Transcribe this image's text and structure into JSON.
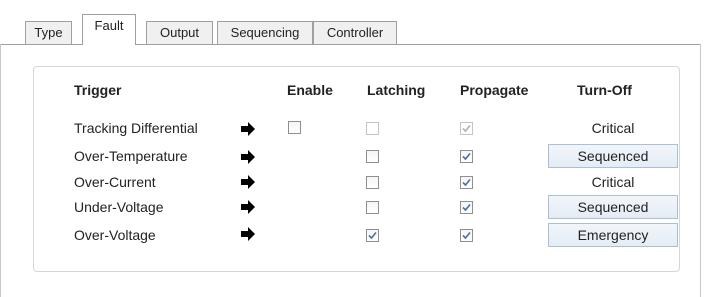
{
  "tabs": [
    {
      "label": "Type",
      "active": false
    },
    {
      "label": "Fault",
      "active": true
    },
    {
      "label": "Output",
      "active": false
    },
    {
      "label": "Sequencing",
      "active": false
    },
    {
      "label": "Controller",
      "active": false
    }
  ],
  "headers": {
    "trigger": "Trigger",
    "enable": "Enable",
    "latching": "Latching",
    "propagate": "Propagate",
    "turn_off": "Turn-Off"
  },
  "rows": [
    {
      "trigger": "Tracking Differential",
      "enable": "unchecked",
      "latching": "disabled-unchecked",
      "propagate": "disabled-checked",
      "turn_off": "Critical",
      "turn_off_style": "text"
    },
    {
      "trigger": "Over-Temperature",
      "enable": "none",
      "latching": "unchecked",
      "propagate": "checked",
      "turn_off": "Sequenced",
      "turn_off_style": "button"
    },
    {
      "trigger": "Over-Current",
      "enable": "none",
      "latching": "unchecked",
      "propagate": "checked",
      "turn_off": "Critical",
      "turn_off_style": "text"
    },
    {
      "trigger": "Under-Voltage",
      "enable": "none",
      "latching": "unchecked",
      "propagate": "checked",
      "turn_off": "Sequenced",
      "turn_off_style": "button"
    },
    {
      "trigger": "Over-Voltage",
      "enable": "none",
      "latching": "checked",
      "propagate": "checked",
      "turn_off": "Emergency",
      "turn_off_style": "button"
    }
  ],
  "icons": {
    "row_arrow": "arrow-right-icon",
    "check": "checkmark-icon"
  },
  "colors": {
    "checkmark": "#4a6fa5",
    "checkmark_disabled": "#b0b0b0",
    "button_border": "#adbfd3"
  }
}
